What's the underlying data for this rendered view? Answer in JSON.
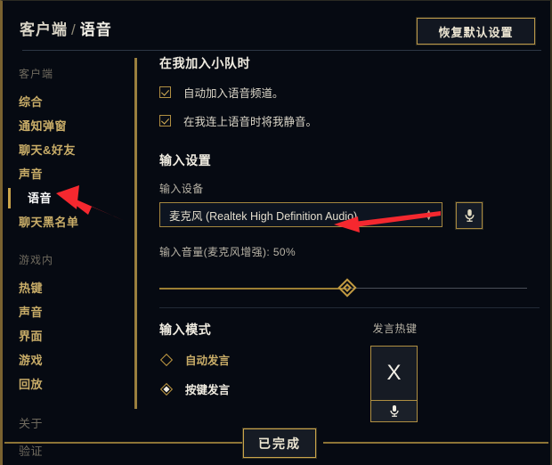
{
  "header": {
    "breadcrumb_root": "客户端",
    "breadcrumb_sep": "/",
    "breadcrumb_current": "语音",
    "reset_button": "恢复默认设置"
  },
  "sidebar": {
    "group_client_label": "客户端",
    "client_items": [
      {
        "label": "综合",
        "active": false
      },
      {
        "label": "通知弹窗",
        "active": false
      },
      {
        "label": "聊天&好友",
        "active": false
      },
      {
        "label": "声音",
        "active": false
      },
      {
        "label": "语音",
        "active": true
      },
      {
        "label": "聊天黑名单",
        "active": false
      }
    ],
    "group_ingame_label": "游戏内",
    "ingame_items": [
      {
        "label": "热键"
      },
      {
        "label": "声音"
      },
      {
        "label": "界面"
      },
      {
        "label": "游戏"
      },
      {
        "label": "回放"
      }
    ],
    "about_label": "关于",
    "verify_label": "验证"
  },
  "main": {
    "join_section": {
      "title": "在我加入小队时",
      "checkboxes": [
        {
          "label": "自动加入语音频道。",
          "checked": true
        },
        {
          "label": "在我连上语音时将我静音。",
          "checked": true
        }
      ]
    },
    "input_section": {
      "title": "输入设置",
      "device_label": "输入设备",
      "device_value": "麦克风 (Realtek High Definition Audio)",
      "mic_test_icon": "microphone-icon",
      "volume_label": "输入音量(麦克风增强): 50%",
      "volume_percent": 50
    },
    "mode_section": {
      "title": "输入模式",
      "options": [
        {
          "label": "自动发言",
          "selected": false
        },
        {
          "label": "按键发言",
          "selected": true
        }
      ],
      "ptt_title": "发言热键",
      "ptt_key": "X",
      "ptt_mic_icon": "microphone-icon"
    }
  },
  "footer": {
    "done_button": "已完成"
  },
  "colors": {
    "background": "#060a12",
    "gold": "#c9a44a",
    "gold_dim": "#9a7f3e",
    "text": "#f0ece1",
    "text_muted": "#6f6a5e",
    "annotation_arrow": "#f5282f"
  },
  "annotations": [
    {
      "name": "arrow-to-voice-nav",
      "color": "#f5282f"
    },
    {
      "name": "arrow-to-volume-label",
      "color": "#f5282f"
    }
  ]
}
